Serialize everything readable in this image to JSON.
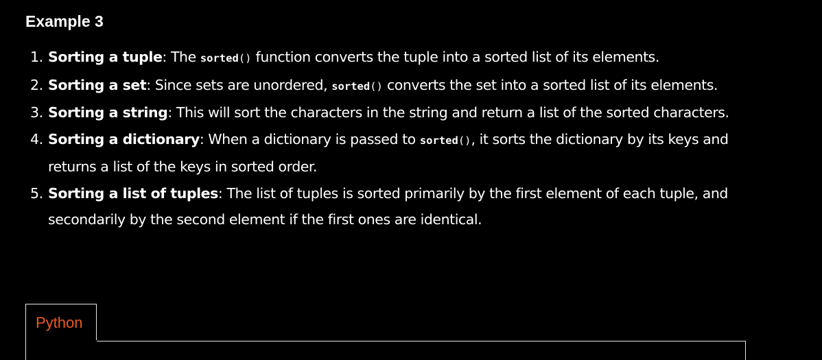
{
  "heading": "Example 3",
  "items": [
    {
      "number": "1.",
      "term": "Sorting a tuple",
      "colon": ":",
      "text_before": " The ",
      "code_name": "sorted",
      "code_paren": "()",
      "text_after": " function converts the tuple into a sorted list of its elements."
    },
    {
      "number": "2.",
      "term": "Sorting a set",
      "colon": ":",
      "text_before": " Since sets are unordered, ",
      "code_name": "sorted",
      "code_paren": "()",
      "text_after": " converts the set into a sorted list of its elements."
    },
    {
      "number": "3.",
      "term": "Sorting a string",
      "colon": ":",
      "text": " This will sort the characters in the string and return a list of the sorted characters."
    },
    {
      "number": "4.",
      "term": "Sorting a dictionary",
      "colon": ":",
      "text_before": " When a dictionary is passed to ",
      "code_name": "sorted",
      "code_paren": "()",
      "text_after": ", it sorts the dictionary by its keys and returns a list of the keys in sorted order."
    },
    {
      "number": "5.",
      "term": "Sorting a list of tuples",
      "colon": ":",
      "text": " The list of tuples is sorted primarily by the first element of each tuple, and secondarily by the second element if the first ones are identical."
    }
  ],
  "code_tab": {
    "label": "Python"
  },
  "colors": {
    "background": "#000000",
    "text": "#ffffff",
    "tab_label": "#f0591f",
    "border": "#e8e8e8"
  }
}
